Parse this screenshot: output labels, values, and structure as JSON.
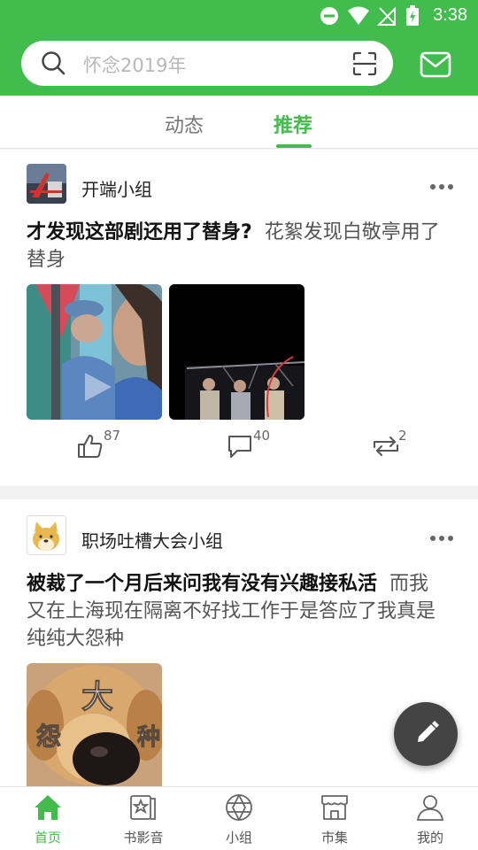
{
  "status_bar": {
    "time": "3:38"
  },
  "search": {
    "placeholder": "怀念2019年"
  },
  "tabs": [
    {
      "label": "动态",
      "active": false
    },
    {
      "label": "推荐",
      "active": true
    }
  ],
  "posts": [
    {
      "group": "开端小组",
      "title": "才发现这部剧还用了替身?",
      "body": "花絮发现白敬亭用了替身",
      "likes": "87",
      "comments": "40",
      "reposts": "2"
    },
    {
      "group": "职场吐槽大会小组",
      "title": "被裁了一个月后来问我有没有兴趣接私活",
      "body": "而我又在上海现在隔离不好找工作于是答应了我真是纯纯大怨种",
      "image_text": {
        "top": "大",
        "left": "怨",
        "right": "种"
      }
    }
  ],
  "bottom_nav": [
    {
      "label": "首页",
      "icon": "home-icon",
      "active": true
    },
    {
      "label": "书影音",
      "icon": "media-icon",
      "active": false
    },
    {
      "label": "小组",
      "icon": "group-icon",
      "active": false
    },
    {
      "label": "市集",
      "icon": "market-icon",
      "active": false
    },
    {
      "label": "我的",
      "icon": "profile-icon",
      "active": false
    }
  ],
  "colors": {
    "accent": "#41bc4d",
    "fab": "#444444",
    "card_bg": "#ffffff",
    "page_bg": "#f2f2f2"
  }
}
